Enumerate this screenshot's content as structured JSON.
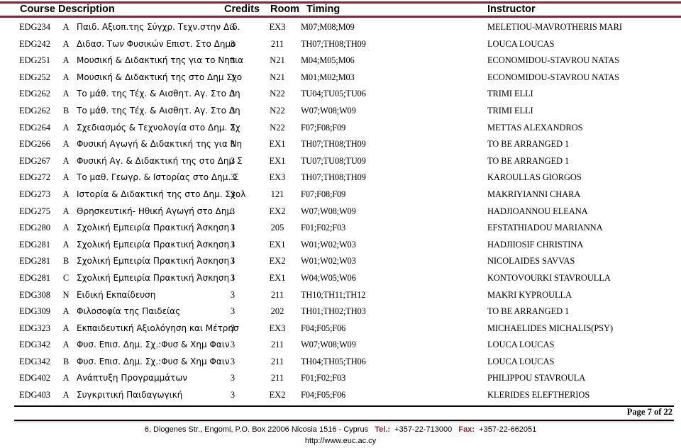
{
  "table": {
    "columns": {
      "course_description": "Course Description",
      "credits": "Credits",
      "room": "Room",
      "timing": "Timing",
      "instructor": "Instructor"
    },
    "rule_color": "#7B2838",
    "rows": [
      {
        "code": "EDG234",
        "section": "A",
        "description": "Παιδ. Αξιοπ.της Σύγχρ. Τεχν.στην Διδ.",
        "credits": "3",
        "room": "EX3",
        "timing": "M07;M08;M09",
        "instructor": "MELETIOU-MAVROTHERIS MARI"
      },
      {
        "code": "EDG242",
        "section": "A",
        "description": "Διδασ. Των Φυσικών Επιστ. Στο Δημο",
        "credits": "3",
        "room": "211",
        "timing": "TH07;TH08;TH09",
        "instructor": "LOUCA LOUCAS"
      },
      {
        "code": "EDG251",
        "section": "A",
        "description": "Μουσική & Διδακτική της για το Νηπια",
        "credits": "3",
        "room": "N21",
        "timing": "M04;M05;M06",
        "instructor": "ECONOMIDOU-STAVROU NATAS"
      },
      {
        "code": "EDG252",
        "section": "A",
        "description": "Μουσική & Διδακτική της στο Δημ Σχο",
        "credits": "3",
        "room": "N21",
        "timing": "M01;M02;M03",
        "instructor": "ECONOMIDOU-STAVROU NATAS"
      },
      {
        "code": "EDG262",
        "section": "A",
        "description": "Το μάθ. της Τέχ. & Αισθητ. Αγ. Στο Δη",
        "credits": "3",
        "room": "N22",
        "timing": "TU04;TU05;TU06",
        "instructor": "TRIMI ELLI"
      },
      {
        "code": "EDG262",
        "section": "B",
        "description": "Το μάθ. της Τέχ. & Αισθητ. Αγ. Στο Δη",
        "credits": "3",
        "room": "N22",
        "timing": "W07;W08;W09",
        "instructor": "TRIMI ELLI"
      },
      {
        "code": "EDG264",
        "section": "A",
        "description": "Σχεδιασμός & Τεχνολογία στο Δημ. Σχ",
        "credits": "3",
        "room": "N22",
        "timing": "F07;F08;F09",
        "instructor": "METTAS ALEXANDROS"
      },
      {
        "code": "EDG266",
        "section": "A",
        "description": "Φυσική Αγωγή & Διδακτική της για Νη",
        "credits": "3",
        "room": "EX1",
        "timing": "TH07;TH08;TH09",
        "instructor": "TO BE ARRANGED 1"
      },
      {
        "code": "EDG267",
        "section": "A",
        "description": "Φυσική Αγ. & Διδακτική της στο Δημ Σ",
        "credits": "3",
        "room": "EX1",
        "timing": "TU07;TU08;TU09",
        "instructor": "TO BE ARRANGED 1"
      },
      {
        "code": "EDG272",
        "section": "A",
        "description": "Το μαθ. Γεωγρ. & Ιστορίας στο Δημ. Σ",
        "credits": "3",
        "room": "EX3",
        "timing": "TH07;TH08;TH09",
        "instructor": "KAROULLAS GIORGOS"
      },
      {
        "code": "EDG273",
        "section": "A",
        "description": "Ιστορία & Διδακτική της στο Δημ. Σχολ",
        "credits": "3",
        "room": "121",
        "timing": "F07;F08;F09",
        "instructor": "MAKRIYIANNI CHARA"
      },
      {
        "code": "EDG275",
        "section": "A",
        "description": "Θρησκευτική- Ηθική Αγωγή στο Δημ.",
        "credits": "3",
        "room": "EX2",
        "timing": "W07;W08;W09",
        "instructor": "HADJIOANNOU ELEANA"
      },
      {
        "code": "EDG280",
        "section": "A",
        "description": "Σχολική Εμπειρία Πρακτική Άσκηση I",
        "credits": "3",
        "room": "205",
        "timing": "F01;F02;F03",
        "instructor": "EFSTATHIADOU MARIANNA"
      },
      {
        "code": "EDG281",
        "section": "A",
        "description": "Σχολική Εμπειρία Πρακτική Άσκηση I",
        "credits": "3",
        "room": "EX1",
        "timing": "W01;W02;W03",
        "instructor": "HADJIIOSIF CHRISTINA"
      },
      {
        "code": "EDG281",
        "section": "B",
        "description": "Σχολική Εμπειρία Πρακτική Άσκηση I",
        "credits": "3",
        "room": "EX2",
        "timing": "W01;W02;W03",
        "instructor": "NICOLAIDES SAVVAS"
      },
      {
        "code": "EDG281",
        "section": "C",
        "description": "Σχολική Εμπειρία Πρακτική Άσκηση I",
        "credits": "3",
        "room": "EX1",
        "timing": "W04;W05;W06",
        "instructor": "KONTOVOURKI STAVROULLA"
      },
      {
        "code": "EDG308",
        "section": "N",
        "description": "Ειδική Εκπαίδευση",
        "credits": "3",
        "room": "211",
        "timing": "TH10;TH11;TH12",
        "instructor": "MAKRI KYPROULLA"
      },
      {
        "code": "EDG309",
        "section": "A",
        "description": "Φιλοσοφία της Παιδείας",
        "credits": "3",
        "room": "202",
        "timing": "TH01;TH02;TH03",
        "instructor": "TO BE ARRANGED 1"
      },
      {
        "code": "EDG323",
        "section": "A",
        "description": "Εκπαιδευτική Αξιολόγηση και Μέτρησ",
        "credits": "3",
        "room": "EX3",
        "timing": "F04;F05;F06",
        "instructor": "MICHAELIDES MICHALIS(PSY)"
      },
      {
        "code": "EDG342",
        "section": "A",
        "description": "Φυσ. Επισ. Δημ. Σχ.:Φυσ & Χημ Φαιν",
        "credits": "3",
        "room": "211",
        "timing": "W07;W08;W09",
        "instructor": "LOUCA LOUCAS"
      },
      {
        "code": "EDG342",
        "section": "B",
        "description": "Φυσ. Επισ. Δημ. Σχ.:Φυσ & Χημ Φαιν",
        "credits": "3",
        "room": "211",
        "timing": "TH04;TH05;TH06",
        "instructor": "LOUCA LOUCAS"
      },
      {
        "code": "EDG402",
        "section": "A",
        "description": "Ανάπτυξη Προγραμμάτων",
        "credits": "3",
        "room": "211",
        "timing": "F01;F02;F03",
        "instructor": "PHILIPPOU STAVROULA"
      },
      {
        "code": "EDG403",
        "section": "A",
        "description": "Συγκριτική Παιδαγωγική",
        "credits": "3",
        "room": "EX2",
        "timing": "F04;F05;F06",
        "instructor": "KLERIDES ELEFTHERIOS"
      }
    ]
  },
  "footer": {
    "page_number": "Page 7 of 22",
    "address": "6, Diogenes Str., Engomi, P.O. Box 22006 Nicosia 1516 - Cyprus",
    "tel_label": "Tel.:",
    "tel_value": "+357-22-713000",
    "fax_label": "Fax:",
    "fax_value": "+357-22-662051",
    "url": "http://www.euc.ac.cy",
    "accent_color": "#9B1B2E"
  }
}
